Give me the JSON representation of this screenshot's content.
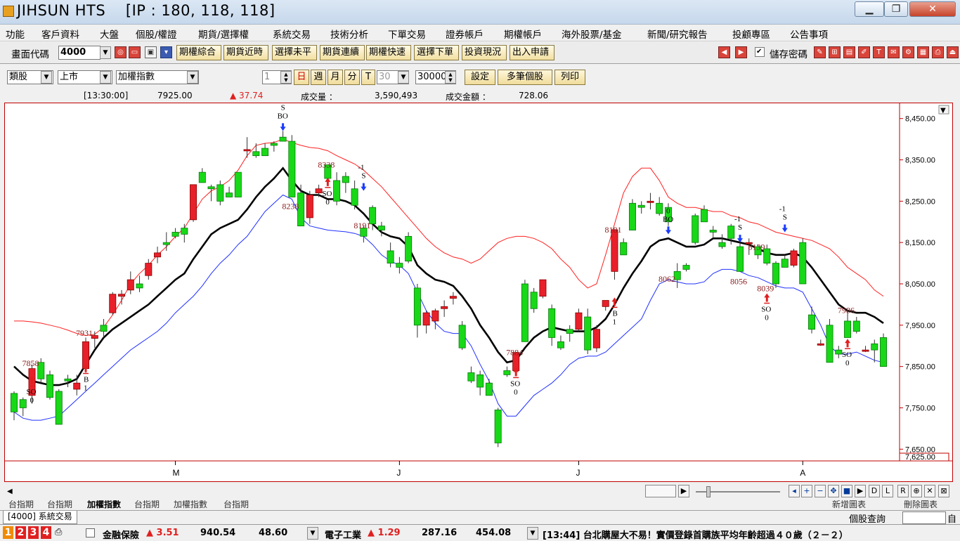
{
  "window": {
    "title": "JIHSUN HTS",
    "ip": "[IP : 180, 118, 118]",
    "minimize": "▁",
    "maximize": "❐",
    "close": "✕"
  },
  "menu": [
    "功能",
    "客戶資料",
    "大盤",
    "個股/權證",
    "期貨/選擇權",
    "系統交易",
    "技術分析",
    "下單交易",
    "證券帳戶",
    "期權帳戶",
    "海外股票/基金",
    "新聞/研究報告",
    "投顧專區",
    "公告事項"
  ],
  "toolbar": {
    "code_label": "畫面代碼",
    "code_value": "4000",
    "buttons": [
      "期權綜合",
      "期貨近時",
      "選擇未平",
      "期貨連續",
      "期權快速",
      "選擇下單",
      "投資現況",
      "出入申請"
    ],
    "save_pwd_label": "儲存密碼",
    "save_pwd_checked": "✔"
  },
  "panel": {
    "category": "類股",
    "market": "上市",
    "index": "加權指數",
    "period_num": "1",
    "day": "日",
    "week": "週",
    "month": "月",
    "minute": "分",
    "tick": "T",
    "minute_value": "30",
    "count_value": "30000",
    "settings": "設定",
    "multi": "多筆個股",
    "print": "列印"
  },
  "info": {
    "time": "[13:30:00]",
    "price": "7925.00",
    "change": "▲ 37.74",
    "volume_label": "成交量 ：",
    "volume": "3,590,493",
    "amount_label": "成交金額 ：",
    "amount": "728.06"
  },
  "colors": {
    "up": "#e8202a",
    "down": "#18d818",
    "upper_band": "#ff2020",
    "lower_band": "#2030ff",
    "middle": "#000000",
    "axis": "#c00000",
    "signal_red": "#e02020",
    "signal_blue": "#1a3cff"
  },
  "chart_data": {
    "type": "candlestick",
    "y_ticks": [
      "8,450.00",
      "8,350.00",
      "8,250.00",
      "8,150.00",
      "8,050.00",
      "7,950.00",
      "7,850.00",
      "7,750.00",
      "7,650.00"
    ],
    "y_bottom_label": "7,625.00",
    "ylim": [
      7625,
      8475
    ],
    "x_months": [
      {
        "label": "M",
        "index": 18
      },
      {
        "label": "J",
        "index": 43
      },
      {
        "label": "J",
        "index": 63
      },
      {
        "label": "A",
        "index": 88
      }
    ],
    "candles": [
      [
        7785,
        7790,
        7720,
        7740
      ],
      [
        7770,
        7775,
        7730,
        7750
      ],
      [
        7780,
        7855,
        7760,
        7845
      ],
      [
        7860,
        7870,
        7810,
        7820
      ],
      [
        7830,
        7840,
        7770,
        7775
      ],
      [
        7790,
        7795,
        7710,
        7710
      ],
      [
        7820,
        7830,
        7800,
        7815
      ],
      [
        7795,
        7830,
        7780,
        7810
      ],
      [
        7845,
        7920,
        7835,
        7910
      ],
      [
        7918,
        7935,
        7895,
        7925
      ],
      [
        7950,
        7965,
        7920,
        7935
      ],
      [
        7980,
        8030,
        7975,
        8025
      ],
      [
        8020,
        8035,
        8000,
        8025
      ],
      [
        8035,
        8080,
        8025,
        8060
      ],
      [
        8050,
        8070,
        8030,
        8040
      ],
      [
        8070,
        8110,
        8060,
        8100
      ],
      [
        8115,
        8140,
        8100,
        8125
      ],
      [
        8150,
        8175,
        8130,
        8145
      ],
      [
        8175,
        8185,
        8160,
        8165
      ],
      [
        8185,
        8195,
        8150,
        8170
      ],
      [
        8205,
        8290,
        8200,
        8290
      ],
      [
        8320,
        8330,
        8295,
        8295
      ],
      [
        8285,
        8290,
        8250,
        8280
      ],
      [
        8290,
        8300,
        8240,
        8250
      ],
      [
        8270,
        8285,
        8260,
        8260
      ],
      [
        8320,
        8320,
        8260,
        8260
      ],
      [
        8375,
        8405,
        8355,
        8375
      ],
      [
        8370,
        8390,
        8355,
        8360
      ],
      [
        8378,
        8390,
        8360,
        8360
      ],
      [
        8390,
        8395,
        8370,
        8385
      ],
      [
        8405,
        8420,
        8395,
        8395
      ],
      [
        8395,
        8410,
        8280,
        8260
      ],
      [
        8270,
        8290,
        8190,
        8190
      ],
      [
        8210,
        8275,
        8195,
        8265
      ],
      [
        8270,
        8290,
        8260,
        8280
      ],
      [
        8338,
        8338,
        8290,
        8305
      ],
      [
        8300,
        8320,
        8240,
        8250
      ],
      [
        8310,
        8320,
        8270,
        8295
      ],
      [
        8280,
        8300,
        8230,
        8240
      ],
      [
        8185,
        8191,
        8150,
        8165
      ],
      [
        8235,
        8240,
        8180,
        8195
      ],
      [
        8190,
        8200,
        8165,
        8180
      ],
      [
        8130,
        8150,
        8090,
        8100
      ],
      [
        8100,
        8115,
        8075,
        8090
      ],
      [
        8165,
        8175,
        8100,
        8105
      ],
      [
        8040,
        8050,
        7920,
        7950
      ],
      [
        7950,
        7985,
        7930,
        7980
      ],
      [
        7960,
        7990,
        7940,
        7985
      ],
      [
        7990,
        8010,
        7970,
        7995
      ],
      [
        8015,
        8030,
        8000,
        8020
      ],
      [
        7950,
        7960,
        7890,
        7895
      ],
      [
        7835,
        7850,
        7810,
        7815
      ],
      [
        7830,
        7840,
        7780,
        7800
      ],
      [
        7810,
        7820,
        7780,
        7780
      ],
      [
        7745,
        7750,
        7655,
        7665
      ],
      [
        7840,
        7850,
        7825,
        7830
      ],
      [
        7840,
        7884,
        7840,
        7884
      ],
      [
        8050,
        8060,
        7910,
        7910
      ],
      [
        8030,
        8040,
        7980,
        7990
      ],
      [
        8020,
        8060,
        8015,
        8060
      ],
      [
        7990,
        8000,
        7900,
        7920
      ],
      [
        7910,
        7925,
        7890,
        7895
      ],
      [
        7940,
        7950,
        7910,
        7930
      ],
      [
        7940,
        7990,
        7935,
        7980
      ],
      [
        7970,
        7990,
        7880,
        7890
      ],
      [
        7895,
        7950,
        7885,
        7940
      ],
      [
        7995,
        8010,
        7985,
        8010
      ],
      [
        8080,
        8181,
        8060,
        8181
      ],
      [
        8150,
        8160,
        8120,
        8120
      ],
      [
        8245,
        8255,
        8180,
        8180
      ],
      [
        8240,
        8250,
        8220,
        8235
      ],
      [
        8250,
        8270,
        8230,
        8250
      ],
      [
        8245,
        8260,
        8215,
        8220
      ],
      [
        8235,
        8245,
        8190,
        8200
      ],
      [
        8080,
        8100,
        8040,
        8060
      ],
      [
        8095,
        8100,
        8080,
        8085
      ],
      [
        8215,
        8220,
        8145,
        8150
      ],
      [
        8230,
        8240,
        8200,
        8200
      ],
      [
        8180,
        8190,
        8160,
        8175
      ],
      [
        8150,
        8170,
        8135,
        8140
      ],
      [
        8190,
        8195,
        8145,
        8160
      ],
      [
        8140,
        8150,
        8080,
        8080
      ],
      [
        8150,
        8160,
        8120,
        8150
      ],
      [
        8140,
        8145,
        8110,
        8120
      ],
      [
        8135,
        8145,
        8095,
        8100
      ],
      [
        8100,
        8105,
        8040,
        8050
      ],
      [
        8110,
        8120,
        8090,
        8090
      ],
      [
        8095,
        8135,
        8090,
        8130
      ],
      [
        8150,
        8160,
        8050,
        8050
      ],
      [
        7975,
        7995,
        7930,
        7940
      ],
      [
        7905,
        7915,
        7900,
        7905
      ],
      [
        7950,
        7965,
        7860,
        7860
      ],
      [
        7890,
        7900,
        7870,
        7880
      ],
      [
        7960,
        7986,
        7920,
        7920
      ],
      [
        7960,
        7970,
        7930,
        7935
      ],
      [
        7890,
        7900,
        7885,
        7890
      ],
      [
        7905,
        7915,
        7860,
        7890
      ],
      [
        7920,
        7930,
        7850,
        7850
      ]
    ],
    "ma_middle": [
      7850,
      7830,
      7815,
      7810,
      7805,
      7805,
      7810,
      7820,
      7855,
      7890,
      7920,
      7940,
      7955,
      7970,
      7985,
      8000,
      8020,
      8040,
      8060,
      8075,
      8110,
      8140,
      8170,
      8185,
      8195,
      8205,
      8230,
      8260,
      8285,
      8305,
      8330,
      8300,
      8275,
      8265,
      8265,
      8255,
      8255,
      8250,
      8240,
      8220,
      8195,
      8175,
      8165,
      8160,
      8140,
      8095,
      8075,
      8060,
      8055,
      8045,
      8020,
      7990,
      7950,
      7920,
      7885,
      7860,
      7865,
      7895,
      7920,
      7935,
      7945,
      7940,
      7935,
      7935,
      7935,
      7945,
      7965,
      8000,
      8040,
      8075,
      8105,
      8140,
      8155,
      8160,
      8150,
      8140,
      8140,
      8145,
      8160,
      8160,
      8155,
      8150,
      8145,
      8135,
      8125,
      8120,
      8120,
      8125,
      8115,
      8090,
      8060,
      8030,
      8000,
      7985,
      7980,
      7980,
      7970,
      7955
    ],
    "band_upper": [
      7960,
      7960,
      7958,
      7955,
      7950,
      7945,
      7938,
      7930,
      7925,
      7928,
      7945,
      7975,
      8010,
      8050,
      8075,
      8095,
      8120,
      8140,
      8165,
      8185,
      8220,
      8255,
      8275,
      8285,
      8300,
      8325,
      8360,
      8385,
      8390,
      8392,
      8400,
      8392,
      8385,
      8380,
      8378,
      8372,
      8360,
      8350,
      8340,
      8325,
      8305,
      8285,
      8260,
      8235,
      8210,
      8185,
      8160,
      8140,
      8125,
      8115,
      8110,
      8100,
      8110,
      8130,
      8150,
      8160,
      8165,
      8165,
      8160,
      8150,
      8135,
      8110,
      8090,
      8060,
      8040,
      8050,
      8120,
      8195,
      8270,
      8310,
      8330,
      8330,
      8300,
      8260,
      8245,
      8235,
      8235,
      8230,
      8225,
      8225,
      8215,
      8210,
      8200,
      8195,
      8185,
      8175,
      8170,
      8165,
      8160,
      8155,
      8145,
      8135,
      8115,
      8090,
      8075,
      8060,
      8035,
      8020
    ],
    "band_lower": [
      7740,
      7725,
      7720,
      7720,
      7725,
      7730,
      7750,
      7770,
      7790,
      7810,
      7830,
      7850,
      7870,
      7890,
      7905,
      7920,
      7935,
      7955,
      7980,
      8000,
      8020,
      8045,
      8075,
      8100,
      8120,
      8145,
      8165,
      8195,
      8225,
      8245,
      8265,
      8255,
      8210,
      8190,
      8185,
      8180,
      8178,
      8176,
      8172,
      8165,
      8145,
      8120,
      8105,
      8095,
      8075,
      8030,
      7985,
      7955,
      7935,
      7930,
      7930,
      7900,
      7855,
      7815,
      7760,
      7730,
      7730,
      7755,
      7780,
      7795,
      7810,
      7830,
      7855,
      7870,
      7875,
      7875,
      7885,
      7905,
      7925,
      7945,
      7965,
      8010,
      8050,
      8060,
      8055,
      8050,
      8050,
      8055,
      8075,
      8085,
      8085,
      8080,
      8070,
      8065,
      8055,
      8045,
      8040,
      8040,
      8030,
      7990,
      7950,
      7900,
      7880,
      7880,
      7885,
      7875,
      7865,
      7860
    ],
    "peak_labels": [
      {
        "text": "7858",
        "i": 2,
        "y": 7858
      },
      {
        "text": "7931",
        "i": 8,
        "y": 7931
      },
      {
        "text": "8238",
        "i": 31,
        "y": 8238
      },
      {
        "text": "8338",
        "i": 35,
        "y": 8338
      },
      {
        "text": "8191",
        "i": 39,
        "y": 8191
      },
      {
        "text": "7884",
        "i": 56,
        "y": 7884
      },
      {
        "text": "8181",
        "i": 67,
        "y": 8181
      },
      {
        "text": "8062",
        "i": 73,
        "y": 8062
      },
      {
        "text": "8139",
        "i": 83,
        "y": 8139
      },
      {
        "text": "8056",
        "i": 81,
        "y": 8056
      },
      {
        "text": "8039",
        "i": 84,
        "y": 8039
      },
      {
        "text": "7986",
        "i": 93,
        "y": 7986
      }
    ],
    "signals": [
      {
        "type": "buy",
        "i": 2,
        "y": 7810,
        "text": [
          "SO",
          "0"
        ]
      },
      {
        "type": "buy",
        "i": 8,
        "y": 7840,
        "text": [
          "B",
          "1"
        ]
      },
      {
        "type": "sell",
        "i": 30,
        "y": 8420,
        "text": [
          "-1",
          "S",
          "BO"
        ]
      },
      {
        "type": "buy",
        "i": 35,
        "y": 8290,
        "text": [
          "SO",
          "0"
        ]
      },
      {
        "type": "sell",
        "i": 39,
        "y": 8275,
        "text": [
          "-1",
          "S"
        ]
      },
      {
        "type": "buy",
        "i": 56,
        "y": 7830,
        "text": [
          "SO",
          "0"
        ]
      },
      {
        "type": "buy",
        "i": 67,
        "y": 8000,
        "text": [
          "B",
          "1"
        ]
      },
      {
        "type": "sell",
        "i": 73,
        "y": 8170,
        "text": [
          "0",
          "BO"
        ]
      },
      {
        "type": "sell",
        "i": 81,
        "y": 8150,
        "text": [
          "-1",
          "S"
        ]
      },
      {
        "type": "buy",
        "i": 84,
        "y": 8010,
        "text": [
          "SO",
          "0"
        ]
      },
      {
        "type": "sell",
        "i": 86,
        "y": 8175,
        "text": [
          "-1",
          "S"
        ]
      },
      {
        "type": "buy",
        "i": 93,
        "y": 7900,
        "text": [
          "SO",
          "0"
        ]
      }
    ]
  },
  "bottom_tabs": [
    "台指期",
    "台指期",
    "加權指數",
    "台指期",
    "加權指數",
    "台指期"
  ],
  "bottom_right_tabs": [
    "新增圖表",
    "刪除圖表"
  ],
  "system_tab": "[4000] 系統交易",
  "stock_query": "個股查詢",
  "stock_query_btn": "自",
  "status": {
    "tabs": [
      "1",
      "2",
      "3",
      "4"
    ],
    "sector1_name": "金融保險",
    "sector1_change": "▲ 3.51",
    "sector1_value": "940.54",
    "sector1_volume": "48.60",
    "sector2_name": "電子工業",
    "sector2_change": "▲ 1.29",
    "sector2_value": "287.16",
    "sector2_volume": "454.08",
    "news": "[13:44] 台北購屋大不易！實價登錄首購族平均年齡超過４０歲（２－２）"
  }
}
